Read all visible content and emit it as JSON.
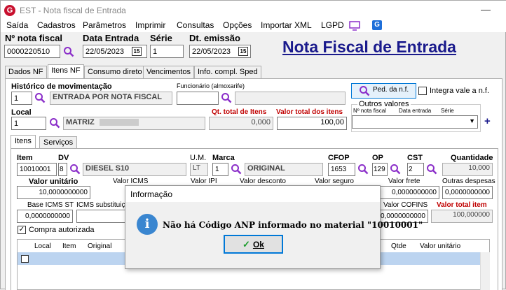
{
  "window": {
    "title": "EST - Nota fiscal de Entrada",
    "minimize": "—"
  },
  "menu": [
    "Saída",
    "Cadastros",
    "Parâmetros",
    "Imprimir",
    "Consultas",
    "Opções",
    "Importar XML",
    "LGPD"
  ],
  "header": {
    "nota_label": "Nº nota fiscal",
    "nota_value": "0000220510",
    "data_entrada_label": "Data Entrada",
    "data_entrada_value": "22/05/2023",
    "serie_label": "Série",
    "serie_value": "1",
    "dt_emissao_label": "Dt. emissão",
    "dt_emissao_value": "22/05/2023",
    "calendar_glyph": "15",
    "heading": "Nota Fiscal de Entrada"
  },
  "tabs": [
    "Dados NF",
    "Itens NF",
    "Consumo direto",
    "Vencimentos",
    "Info. compl. Sped"
  ],
  "itens_nf": {
    "hist_label": "Histórico de movimentação",
    "hist_code": "1",
    "hist_desc": "ENTRADA POR NOTA FISCAL",
    "func_label": "Funcionário (almoxarife)",
    "func_code": "",
    "ped_button": "Ped. da n.f.",
    "integra_label": "Integra vale a n.f.",
    "local_label": "Local",
    "local_code": "1",
    "local_desc": "MATRIZ",
    "qt_total_label": "Qt. total de Itens",
    "qt_total_value": "0,000",
    "valor_total_label": "Valor total dos itens",
    "valor_total_value": "100,00",
    "outros_label": "Outros valores",
    "outros_nota": "Nº nota fiscal",
    "outros_data": "Data entrada",
    "outros_serie": "Série",
    "add_glyph": "+"
  },
  "sub_tabs": [
    "Itens",
    "Serviços"
  ],
  "item": {
    "item_label": "Item",
    "item_value": "10010001",
    "dv_label": "DV",
    "dv_value": "8",
    "dv_desc": "DIESEL S10",
    "um_label": "U.M.",
    "um_value": "LT",
    "marca_label": "Marca",
    "marca_code": "1",
    "marca_desc": "ORIGINAL",
    "cfop_label": "CFOP",
    "cfop_value": "1653",
    "op_label": "OP",
    "op_value": "129",
    "cst_label": "CST",
    "cst_value": "2",
    "qtd_label": "Quantidade",
    "qtd_value": "10,000",
    "vu_label": "Valor unitário",
    "vu_value": "10,0000000000",
    "vicms_label": "Valor ICMS",
    "vipi_label": "Valor IPI",
    "vdesc_label": "Valor desconto",
    "vseg_label": "Valor seguro",
    "vfrete_label": "Valor frete",
    "vfrete_value": "0,0000000000",
    "outras_label": "Outras despesas",
    "outras_value": "0,0000000000",
    "bcst_label": "Base ICMS ST",
    "bcst_value": "0,0000000000",
    "icmsst_label": "ICMS substituição",
    "cofins_label": "Valor COFINS",
    "cofins_value": "0,0000000000",
    "vti_label": "Valor total item",
    "vti_value": "100,000000",
    "compra_label": "Compra autorizada"
  },
  "grid_headers": {
    "local": "Local",
    "item": "Item",
    "original": "Original",
    "qtde": "Qtde",
    "vu": "Valor unitário"
  },
  "dialog": {
    "title": "Informação",
    "icon": "i",
    "message": "Não há Código ANP informado no material \"10010001\"",
    "ok": "Ok"
  },
  "colors": {
    "heading": "#1a1a8c",
    "required": "#c00000",
    "accent": "#0078d7"
  }
}
